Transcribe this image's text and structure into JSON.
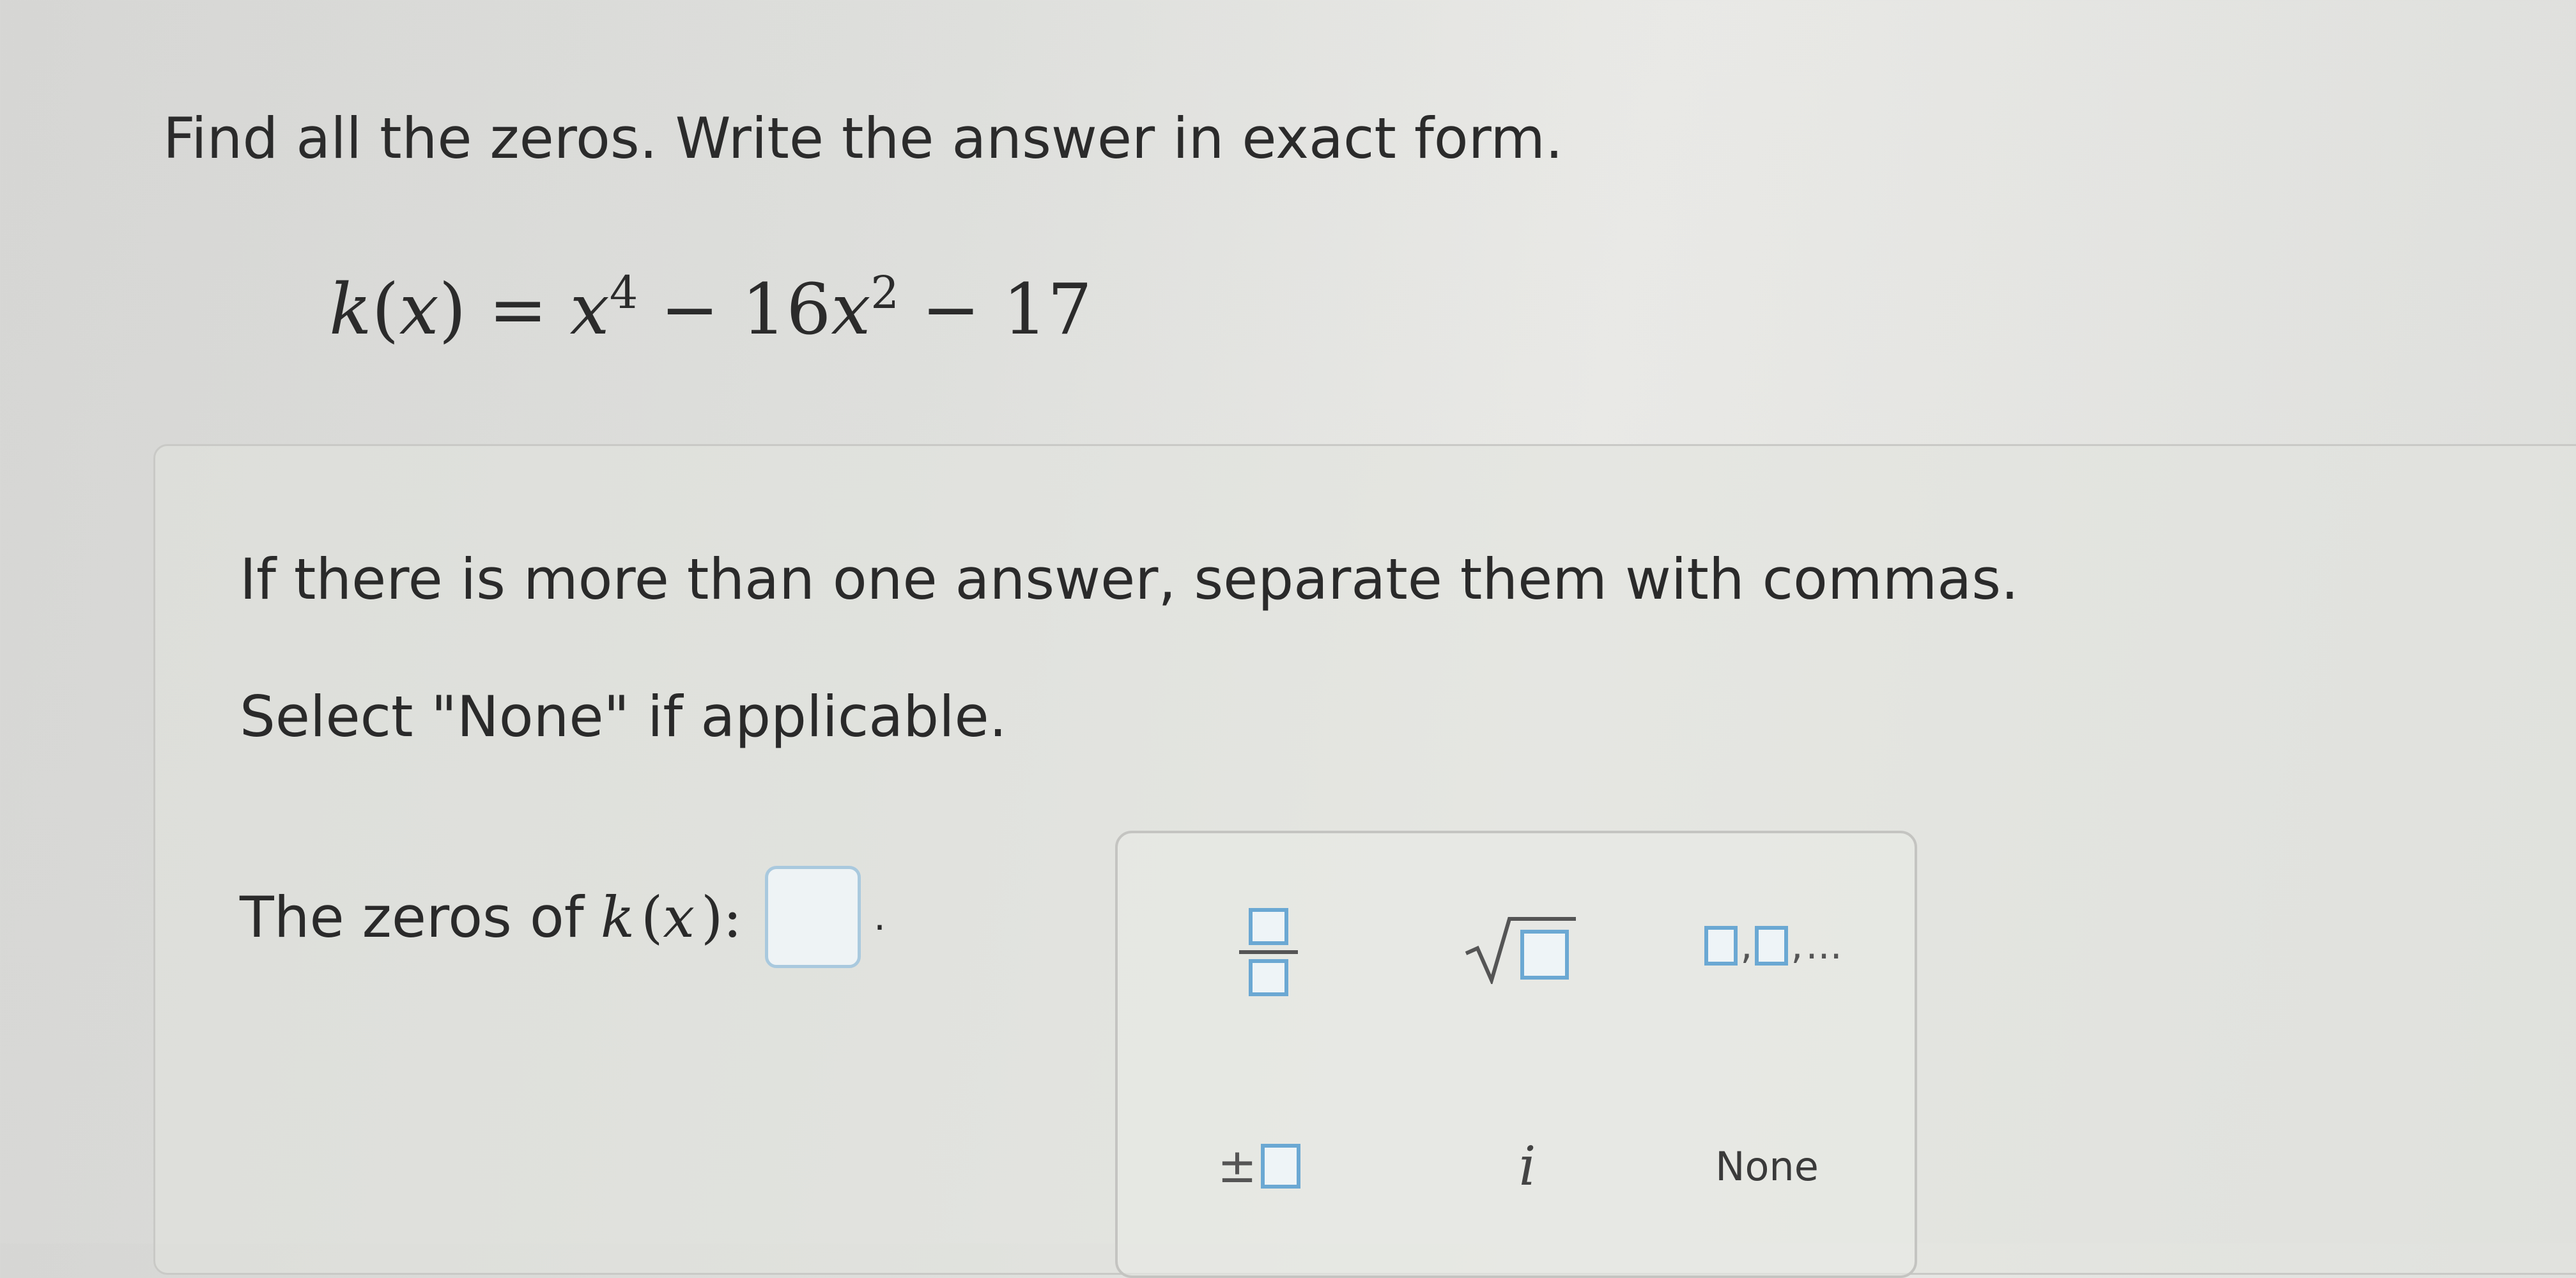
{
  "question": {
    "instruction": "Find all the zeros. Write the answer in exact form.",
    "equation": {
      "func": "k",
      "open_paren": "(",
      "arg": "x",
      "close_paren": ")",
      "equals": " = ",
      "term1_var": "x",
      "term1_exp": "4",
      "minus1": " − 16",
      "term2_var": "x",
      "term2_exp": "2",
      "minus2": " − 17"
    }
  },
  "answer_panel": {
    "hint_multiple": "If there is more than one answer, separate them with commas.",
    "hint_none": "Select \"None\" if applicable.",
    "zeros_prefix": "The zeros of",
    "zeros_func": "k",
    "zeros_open": "(",
    "zeros_arg": "x",
    "zeros_close": "):",
    "answer_value": "",
    "period": "."
  },
  "palette": {
    "list_ellipsis": "...",
    "plus_minus": "±",
    "imaginary": "i",
    "none_label": "None"
  },
  "colors": {
    "input_border": "#a9c9de",
    "icon_box_border": "#6ba8d3"
  }
}
